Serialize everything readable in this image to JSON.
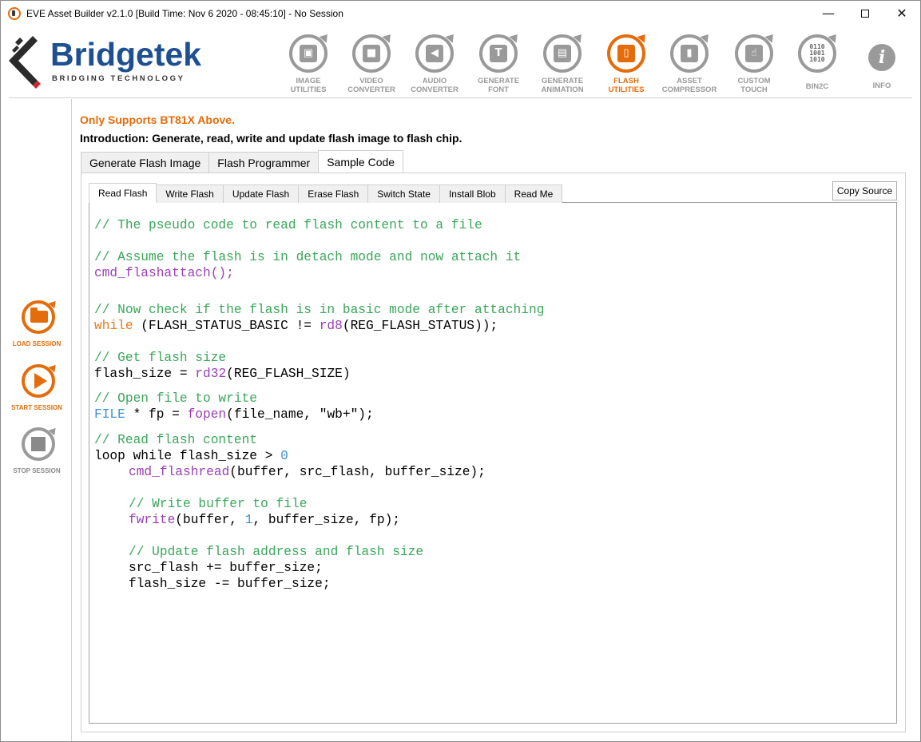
{
  "window": {
    "title": "EVE Asset Builder v2.1.0 [Build Time: Nov  6 2020 - 08:45:10] - No Session",
    "minimize": "—",
    "close": "✕"
  },
  "logo": {
    "name": "Bridgetek",
    "tagline": "BRIDGING     TECHNOLOGY"
  },
  "toolbar": {
    "image": {
      "line1": "IMAGE",
      "line2": "UTILITIES",
      "glyph": "▣"
    },
    "video": {
      "line1": "VIDEO",
      "line2": "CONVERTER",
      "glyph": "■"
    },
    "audio": {
      "line1": "AUDIO",
      "line2": "CONVERTER",
      "glyph": "◀"
    },
    "font": {
      "line1": "GENERATE",
      "line2": "FONT",
      "glyph": "T"
    },
    "animation": {
      "line1": "GENERATE",
      "line2": "ANIMATION",
      "glyph": "▤"
    },
    "flash": {
      "line1": "FLASH",
      "line2": "UTILITIES",
      "glyph": "▯"
    },
    "compressor": {
      "line1": "ASSET",
      "line2": "COMPRESSOR",
      "glyph": "▮"
    },
    "touch": {
      "line1": "CUSTOM",
      "line2": "TOUCH",
      "glyph": "☝"
    },
    "bin2c": {
      "line1": "BIN2C",
      "glyph_1": "0110",
      "glyph_2": "1001",
      "glyph_3": "1010"
    },
    "info": {
      "line1": "INFO",
      "glyph": "i"
    }
  },
  "sidebar": {
    "load": "LOAD SESSION",
    "start": "START SESSION",
    "stop": "STOP SESSION"
  },
  "notice": "Only Supports BT81X Above.",
  "intro": "Introduction: Generate, read, write and update flash image to flash chip.",
  "outer_tabs": [
    "Generate Flash Image",
    "Flash Programmer",
    "Sample Code"
  ],
  "inner_tabs": [
    "Read Flash",
    "Write Flash",
    "Update Flash",
    "Erase Flash",
    "Switch State",
    "Install Blob",
    "Read Me"
  ],
  "copy_button": "Copy Source",
  "code": {
    "l1": "// The pseudo code to read flash content to a file",
    "l2": "// Assume the flash is in detach mode and now attach it",
    "l3": "cmd_flashattach();",
    "l4_kw": "while",
    "l4_a": " (FLASH_STATUS_BASIC != ",
    "l4_fn": "rd8",
    "l4_b": "(REG_FLASH_STATUS));",
    "l4c": "// Now check if the flash is in basic mode after attaching",
    "l5": "// Get flash size",
    "l6_a": "flash_size = ",
    "l6_fn": "rd32",
    "l6_b": "(REG_FLASH_SIZE)",
    "l7": "// Open file to write",
    "l8_ty": "FILE",
    "l8_a": " * fp = ",
    "l8_fn": "fopen",
    "l8_b": "(file_name, \"wb+\");",
    "l9": "// Read flash content",
    "l10_a": "loop while flash_size > ",
    "l10_num": "0",
    "l11_fn": "cmd_flashread",
    "l11_b": "(buffer, src_flash, buffer_size);",
    "l12": "// Write buffer to file",
    "l13_fn": "fwrite",
    "l13_a": "(buffer, ",
    "l13_num": "1",
    "l13_b": ", buffer_size, fp);",
    "l14": "// Update flash address and flash size",
    "l15": "src_flash += buffer_size;",
    "l16": "flash_size -= buffer_size;"
  }
}
